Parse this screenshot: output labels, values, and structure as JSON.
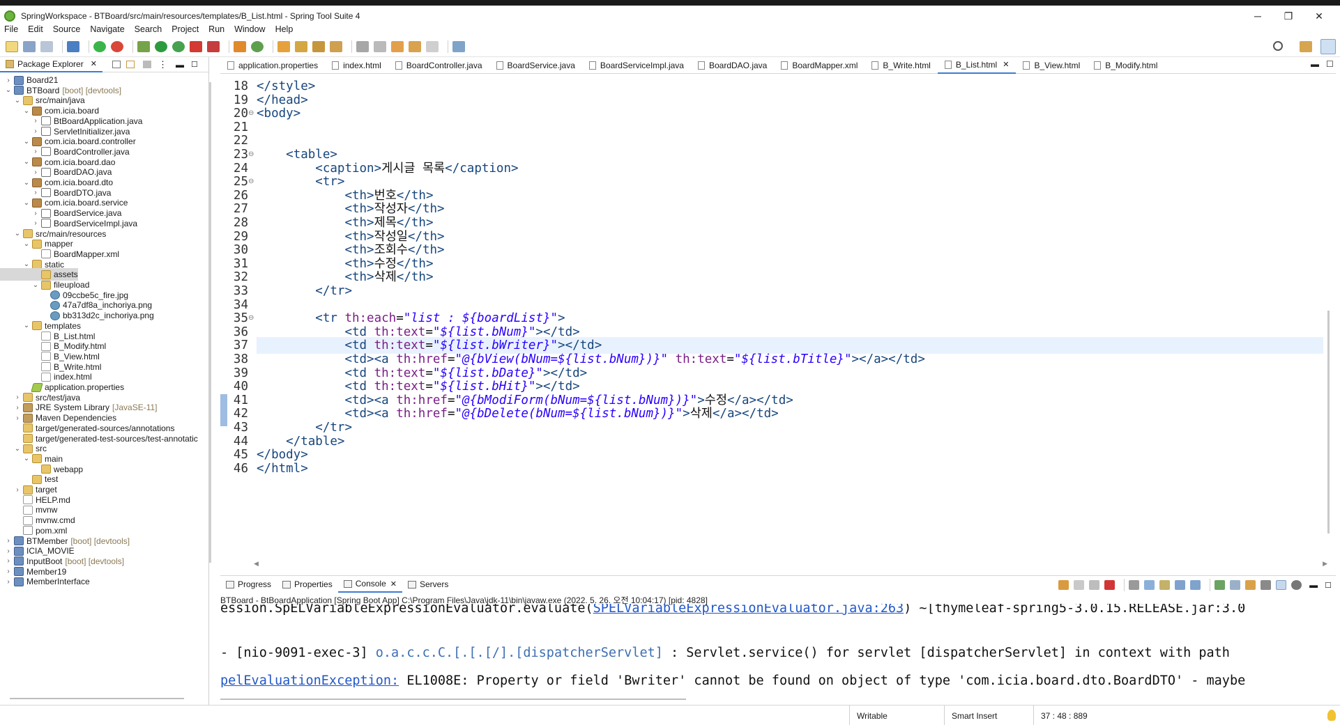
{
  "window": {
    "title": "SpringWorkspace - BTBoard/src/main/resources/templates/B_List.html - Spring Tool Suite 4",
    "minimize": "─",
    "maximize": "❐",
    "close": "✕"
  },
  "menu": [
    "File",
    "Edit",
    "Source",
    "Navigate",
    "Search",
    "Project",
    "Run",
    "Window",
    "Help"
  ],
  "sidebar": {
    "tab_label": "Package Explorer",
    "tree": [
      {
        "indent": 0,
        "twisty": ">",
        "icon": "proj",
        "label": "Board21",
        "dec": ""
      },
      {
        "indent": 0,
        "twisty": "v",
        "icon": "proj",
        "label": "BTBoard",
        "dec": "[boot] [devtools]"
      },
      {
        "indent": 1,
        "twisty": "v",
        "icon": "folder",
        "label": "src/main/java",
        "dec": ""
      },
      {
        "indent": 2,
        "twisty": "v",
        "icon": "pkg",
        "label": "com.icia.board",
        "dec": ""
      },
      {
        "indent": 3,
        "twisty": ">",
        "icon": "java",
        "label": "BtBoardApplication.java",
        "dec": ""
      },
      {
        "indent": 3,
        "twisty": ">",
        "icon": "java",
        "label": "ServletInitializer.java",
        "dec": ""
      },
      {
        "indent": 2,
        "twisty": "v",
        "icon": "pkg",
        "label": "com.icia.board.controller",
        "dec": ""
      },
      {
        "indent": 3,
        "twisty": ">",
        "icon": "java",
        "label": "BoardController.java",
        "dec": ""
      },
      {
        "indent": 2,
        "twisty": "v",
        "icon": "pkg",
        "label": "com.icia.board.dao",
        "dec": ""
      },
      {
        "indent": 3,
        "twisty": ">",
        "icon": "java",
        "label": "BoardDAO.java",
        "dec": ""
      },
      {
        "indent": 2,
        "twisty": "v",
        "icon": "pkg",
        "label": "com.icia.board.dto",
        "dec": ""
      },
      {
        "indent": 3,
        "twisty": ">",
        "icon": "java",
        "label": "BoardDTO.java",
        "dec": ""
      },
      {
        "indent": 2,
        "twisty": "v",
        "icon": "pkg",
        "label": "com.icia.board.service",
        "dec": ""
      },
      {
        "indent": 3,
        "twisty": ">",
        "icon": "java",
        "label": "BoardService.java",
        "dec": ""
      },
      {
        "indent": 3,
        "twisty": ">",
        "icon": "java",
        "label": "BoardServiceImpl.java",
        "dec": ""
      },
      {
        "indent": 1,
        "twisty": "v",
        "icon": "folder",
        "label": "src/main/resources",
        "dec": ""
      },
      {
        "indent": 2,
        "twisty": "v",
        "icon": "folder",
        "label": "mapper",
        "dec": ""
      },
      {
        "indent": 3,
        "twisty": "",
        "icon": "xml",
        "label": "BoardMapper.xml",
        "dec": ""
      },
      {
        "indent": 2,
        "twisty": "v",
        "icon": "folder",
        "label": "static",
        "dec": ""
      },
      {
        "indent": 3,
        "twisty": "",
        "icon": "folder",
        "label": "assets",
        "dec": "",
        "selected": true
      },
      {
        "indent": 3,
        "twisty": "v",
        "icon": "folder",
        "label": "fileupload",
        "dec": ""
      },
      {
        "indent": 4,
        "twisty": "",
        "icon": "img",
        "label": "09ccbe5c_fire.jpg",
        "dec": ""
      },
      {
        "indent": 4,
        "twisty": "",
        "icon": "img",
        "label": "47a7df8a_inchoriya.png",
        "dec": ""
      },
      {
        "indent": 4,
        "twisty": "",
        "icon": "img",
        "label": "bb313d2c_inchoriya.png",
        "dec": ""
      },
      {
        "indent": 2,
        "twisty": "v",
        "icon": "folder",
        "label": "templates",
        "dec": ""
      },
      {
        "indent": 3,
        "twisty": "",
        "icon": "file",
        "label": "B_List.html",
        "dec": ""
      },
      {
        "indent": 3,
        "twisty": "",
        "icon": "file",
        "label": "B_Modify.html",
        "dec": ""
      },
      {
        "indent": 3,
        "twisty": "",
        "icon": "file",
        "label": "B_View.html",
        "dec": ""
      },
      {
        "indent": 3,
        "twisty": "",
        "icon": "file",
        "label": "B_Write.html",
        "dec": ""
      },
      {
        "indent": 3,
        "twisty": "",
        "icon": "file",
        "label": "index.html",
        "dec": ""
      },
      {
        "indent": 2,
        "twisty": "",
        "icon": "prop",
        "label": "application.properties",
        "dec": ""
      },
      {
        "indent": 1,
        "twisty": ">",
        "icon": "folder",
        "label": "src/test/java",
        "dec": ""
      },
      {
        "indent": 1,
        "twisty": ">",
        "icon": "lib",
        "label": "JRE System Library",
        "dec": "[JavaSE-11]"
      },
      {
        "indent": 1,
        "twisty": ">",
        "icon": "lib",
        "label": "Maven Dependencies",
        "dec": ""
      },
      {
        "indent": 1,
        "twisty": "",
        "icon": "folder",
        "label": "target/generated-sources/annotations",
        "dec": ""
      },
      {
        "indent": 1,
        "twisty": "",
        "icon": "folder",
        "label": "target/generated-test-sources/test-annotatic",
        "dec": ""
      },
      {
        "indent": 1,
        "twisty": "v",
        "icon": "folder",
        "label": "src",
        "dec": ""
      },
      {
        "indent": 2,
        "twisty": "v",
        "icon": "folder",
        "label": "main",
        "dec": ""
      },
      {
        "indent": 3,
        "twisty": "",
        "icon": "folder",
        "label": "webapp",
        "dec": ""
      },
      {
        "indent": 2,
        "twisty": "",
        "icon": "folder",
        "label": "test",
        "dec": ""
      },
      {
        "indent": 1,
        "twisty": ">",
        "icon": "folder",
        "label": "target",
        "dec": ""
      },
      {
        "indent": 1,
        "twisty": "",
        "icon": "file",
        "label": "HELP.md",
        "dec": ""
      },
      {
        "indent": 1,
        "twisty": "",
        "icon": "file",
        "label": "mvnw",
        "dec": ""
      },
      {
        "indent": 1,
        "twisty": "",
        "icon": "file",
        "label": "mvnw.cmd",
        "dec": ""
      },
      {
        "indent": 1,
        "twisty": "",
        "icon": "xml",
        "label": "pom.xml",
        "dec": ""
      },
      {
        "indent": 0,
        "twisty": ">",
        "icon": "proj",
        "label": "BTMember",
        "dec": "[boot] [devtools]"
      },
      {
        "indent": 0,
        "twisty": ">",
        "icon": "proj",
        "label": "ICIA_MOVIE",
        "dec": ""
      },
      {
        "indent": 0,
        "twisty": ">",
        "icon": "proj",
        "label": "InputBoot",
        "dec": "[boot] [devtools]"
      },
      {
        "indent": 0,
        "twisty": ">",
        "icon": "proj",
        "label": "Member19",
        "dec": ""
      },
      {
        "indent": 0,
        "twisty": ">",
        "icon": "proj",
        "label": "MemberInterface",
        "dec": ""
      }
    ]
  },
  "editor": {
    "tabs": [
      {
        "label": "application.properties",
        "active": false
      },
      {
        "label": "index.html",
        "active": false
      },
      {
        "label": "BoardController.java",
        "active": false
      },
      {
        "label": "BoardService.java",
        "active": false
      },
      {
        "label": "BoardServiceImpl.java",
        "active": false
      },
      {
        "label": "BoardDAO.java",
        "active": false
      },
      {
        "label": "BoardMapper.xml",
        "active": false
      },
      {
        "label": "B_Write.html",
        "active": false
      },
      {
        "label": "B_List.html",
        "active": true
      },
      {
        "label": "B_View.html",
        "active": false
      },
      {
        "label": "B_Modify.html",
        "active": false
      }
    ],
    "lines": [
      {
        "n": "18",
        "fold": "",
        "indent": 0,
        "parts": [
          [
            "tag",
            "</style>"
          ]
        ]
      },
      {
        "n": "19",
        "fold": "",
        "indent": 0,
        "parts": [
          [
            "tag",
            "</head>"
          ]
        ]
      },
      {
        "n": "20",
        "fold": "⊖",
        "indent": 0,
        "parts": [
          [
            "tag",
            "<body>"
          ]
        ]
      },
      {
        "n": "21",
        "fold": "",
        "indent": 0,
        "parts": []
      },
      {
        "n": "22",
        "fold": "",
        "indent": 0,
        "parts": []
      },
      {
        "n": "23",
        "fold": "⊖",
        "indent": 4,
        "parts": [
          [
            "tag",
            "<table>"
          ]
        ]
      },
      {
        "n": "24",
        "fold": "",
        "indent": 8,
        "parts": [
          [
            "tag",
            "<caption>"
          ],
          [
            "txt",
            "게시글 목록"
          ],
          [
            "tag",
            "</caption>"
          ]
        ]
      },
      {
        "n": "25",
        "fold": "⊖",
        "indent": 8,
        "parts": [
          [
            "tag",
            "<tr>"
          ]
        ]
      },
      {
        "n": "26",
        "fold": "",
        "indent": 12,
        "parts": [
          [
            "tag",
            "<th>"
          ],
          [
            "txt",
            "번호"
          ],
          [
            "tag",
            "</th>"
          ]
        ]
      },
      {
        "n": "27",
        "fold": "",
        "indent": 12,
        "parts": [
          [
            "tag",
            "<th>"
          ],
          [
            "txt",
            "작성자"
          ],
          [
            "tag",
            "</th>"
          ]
        ]
      },
      {
        "n": "28",
        "fold": "",
        "indent": 12,
        "parts": [
          [
            "tag",
            "<th>"
          ],
          [
            "txt",
            "제목"
          ],
          [
            "tag",
            "</th>"
          ]
        ]
      },
      {
        "n": "29",
        "fold": "",
        "indent": 12,
        "parts": [
          [
            "tag",
            "<th>"
          ],
          [
            "txt",
            "작성일"
          ],
          [
            "tag",
            "</th>"
          ]
        ]
      },
      {
        "n": "30",
        "fold": "",
        "indent": 12,
        "parts": [
          [
            "tag",
            "<th>"
          ],
          [
            "txt",
            "조회수"
          ],
          [
            "tag",
            "</th>"
          ]
        ]
      },
      {
        "n": "31",
        "fold": "",
        "indent": 12,
        "parts": [
          [
            "tag",
            "<th>"
          ],
          [
            "txt",
            "수정"
          ],
          [
            "tag",
            "</th>"
          ]
        ]
      },
      {
        "n": "32",
        "fold": "",
        "indent": 12,
        "parts": [
          [
            "tag",
            "<th>"
          ],
          [
            "txt",
            "삭제"
          ],
          [
            "tag",
            "</th>"
          ]
        ]
      },
      {
        "n": "33",
        "fold": "",
        "indent": 8,
        "parts": [
          [
            "tag",
            "</tr>"
          ]
        ]
      },
      {
        "n": "34",
        "fold": "",
        "indent": 0,
        "parts": []
      },
      {
        "n": "35",
        "fold": "⊖",
        "indent": 8,
        "parts": [
          [
            "tag",
            "<tr "
          ],
          [
            "attr",
            "th:each"
          ],
          [
            "txt",
            "="
          ],
          [
            "str",
            "\"list : ${boardList}\""
          ],
          [
            "tag",
            ">"
          ]
        ]
      },
      {
        "n": "36",
        "fold": "",
        "indent": 12,
        "parts": [
          [
            "tag",
            "<td "
          ],
          [
            "attr",
            "th:text"
          ],
          [
            "txt",
            "="
          ],
          [
            "str",
            "\"${list.bNum}\""
          ],
          [
            "tag",
            "></td>"
          ]
        ]
      },
      {
        "n": "37",
        "fold": "",
        "indent": 12,
        "current": true,
        "parts": [
          [
            "tag",
            "<td "
          ],
          [
            "attr",
            "th:text"
          ],
          [
            "txt",
            "="
          ],
          [
            "str",
            "\"${list.bWriter}\""
          ],
          [
            "tag",
            "><"
          ],
          [
            "tag",
            "/td>"
          ]
        ]
      },
      {
        "n": "38",
        "fold": "",
        "indent": 12,
        "parts": [
          [
            "tag",
            "<td><a "
          ],
          [
            "attr",
            "th:href"
          ],
          [
            "txt",
            "="
          ],
          [
            "str",
            "\"@{bView(bNum=${list.bNum})}\""
          ],
          [
            "txt",
            " "
          ],
          [
            "attr",
            "th:text"
          ],
          [
            "txt",
            "="
          ],
          [
            "str",
            "\"${list.bTitle}\""
          ],
          [
            "tag",
            "></a></td>"
          ]
        ]
      },
      {
        "n": "39",
        "fold": "",
        "indent": 12,
        "parts": [
          [
            "tag",
            "<td "
          ],
          [
            "attr",
            "th:text"
          ],
          [
            "txt",
            "="
          ],
          [
            "str",
            "\"${list.bDate}\""
          ],
          [
            "tag",
            "></td>"
          ]
        ]
      },
      {
        "n": "40",
        "fold": "",
        "indent": 12,
        "parts": [
          [
            "tag",
            "<td "
          ],
          [
            "attr",
            "th:text"
          ],
          [
            "txt",
            "="
          ],
          [
            "str",
            "\"${list.bHit}\""
          ],
          [
            "tag",
            "></td>"
          ]
        ]
      },
      {
        "n": "41",
        "fold": "",
        "indent": 12,
        "parts": [
          [
            "tag",
            "<td><a "
          ],
          [
            "attr",
            "th:href"
          ],
          [
            "txt",
            "="
          ],
          [
            "str",
            "\"@{bModiForm(bNum=${list.bNum})}\""
          ],
          [
            "tag",
            ">"
          ],
          [
            "txt",
            "수정"
          ],
          [
            "tag",
            "</a></td>"
          ]
        ]
      },
      {
        "n": "42",
        "fold": "",
        "indent": 12,
        "parts": [
          [
            "tag",
            "<td><a "
          ],
          [
            "attr",
            "th:href"
          ],
          [
            "txt",
            "="
          ],
          [
            "str",
            "\"@{bDelete(bNum=${list.bNum})}\""
          ],
          [
            "tag",
            ">"
          ],
          [
            "txt",
            "삭제"
          ],
          [
            "tag",
            "</a></td>"
          ]
        ]
      },
      {
        "n": "43",
        "fold": "",
        "indent": 8,
        "parts": [
          [
            "tag",
            "</tr>"
          ]
        ]
      },
      {
        "n": "44",
        "fold": "",
        "indent": 4,
        "parts": [
          [
            "tag",
            "</table>"
          ]
        ]
      },
      {
        "n": "45",
        "fold": "",
        "indent": 0,
        "parts": [
          [
            "tag",
            "</body>"
          ]
        ]
      },
      {
        "n": "46",
        "fold": "",
        "indent": 0,
        "parts": [
          [
            "tag",
            "</html>"
          ]
        ]
      }
    ]
  },
  "console": {
    "tabs": [
      {
        "label": "Progress",
        "active": false
      },
      {
        "label": "Properties",
        "active": false
      },
      {
        "label": "Console",
        "active": true
      },
      {
        "label": "Servers",
        "active": false
      }
    ],
    "description": "BTBoard - BtBoardApplication [Spring Boot App] C:\\Program Files\\Java\\jdk-11\\bin\\javaw.exe  (2022. 5. 26. 오전 10:04:17) [pid: 4828]",
    "line1_pre": "ession.SpELVariableExpressionEvaluator.evaluate(",
    "line1_link": "SPELVariableExpressionEvaluator.java:263",
    "line1_post": ") ~[thymeleaf-spring5-3.0.15.RELEASE.jar:3.0",
    "line2_pre": "- [nio-9091-exec-3] ",
    "line2_blue": "o.a.c.c.C.[.[.[/].[dispatcherServlet]",
    "line2_post": "    : Servlet.service() for servlet [dispatcherServlet] in context with path",
    "line3_link": "pelEvaluationException:",
    "line3_post": " EL1008E: Property or field 'Bwriter' cannot be found on object of type 'com.icia.board.dto.BoardDTO' - maybe"
  },
  "status": {
    "writable": "Writable",
    "insert_mode": "Smart Insert",
    "position": "37 : 48 : 889"
  }
}
